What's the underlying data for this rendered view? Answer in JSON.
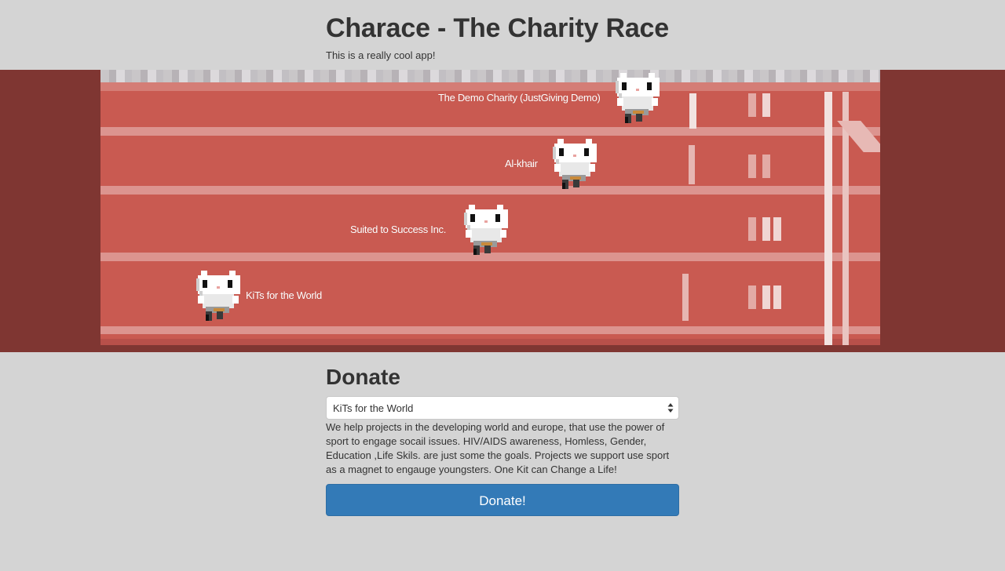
{
  "header": {
    "title": "Charace - The Charity Race",
    "tagline": "This is a really cool app!"
  },
  "race": {
    "runners": [
      {
        "label": "The Demo Charity (JustGiving Demo)",
        "icon": "cat-runner-icon"
      },
      {
        "label": "Al-khair",
        "icon": "cat-runner-icon"
      },
      {
        "label": "Suited to Success Inc.",
        "icon": "cat-runner-icon"
      },
      {
        "label": "KiTs for the World",
        "icon": "cat-runner-icon"
      }
    ]
  },
  "donate": {
    "heading": "Donate",
    "selected_charity": "KiTs for the World",
    "description": "We help projects in the developing world and europe, that use the power of sport to engage socail issues.  HIV/AIDS awareness, Homless, Gender, Education ,Life Skils. are just some the goals. Projects we support use sport as a magnet to engauge youngsters.   One Kit can Change a Life!",
    "button_label": "Donate!"
  },
  "colors": {
    "background": "#d4d4d4",
    "band": "#7f3632",
    "track": "#c95a51",
    "button": "#337ab7"
  }
}
